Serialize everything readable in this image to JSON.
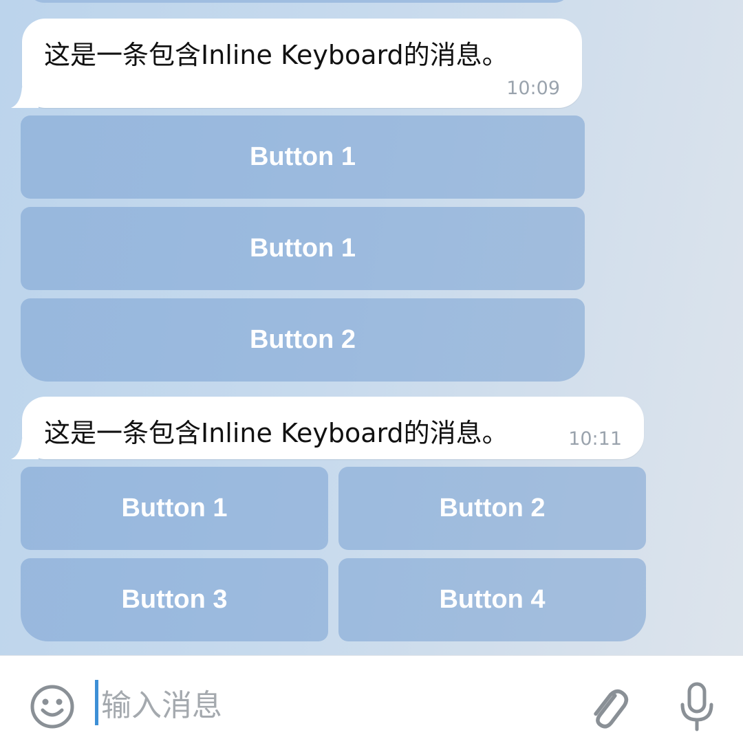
{
  "messages": [
    {
      "text": "这是一条包含Inline Keyboard的消息。",
      "time": "10:09",
      "keyboard": [
        [
          "Button 1"
        ],
        [
          "Button 1"
        ],
        [
          "Button 2"
        ]
      ]
    },
    {
      "text": "这是一条包含Inline Keyboard的消息。",
      "time": "10:11",
      "keyboard": [
        [
          "Button 1",
          "Button 2"
        ],
        [
          "Button 3",
          "Button 4"
        ]
      ]
    }
  ],
  "input": {
    "placeholder": "输入消息"
  },
  "icons": {
    "emoji": "emoji-smile-icon",
    "attach": "paperclip-icon",
    "voice": "microphone-icon"
  },
  "colors": {
    "caret": "#3d8fd6",
    "bubble": "#ffffff",
    "keyboard_button": "#8fb2dc"
  }
}
